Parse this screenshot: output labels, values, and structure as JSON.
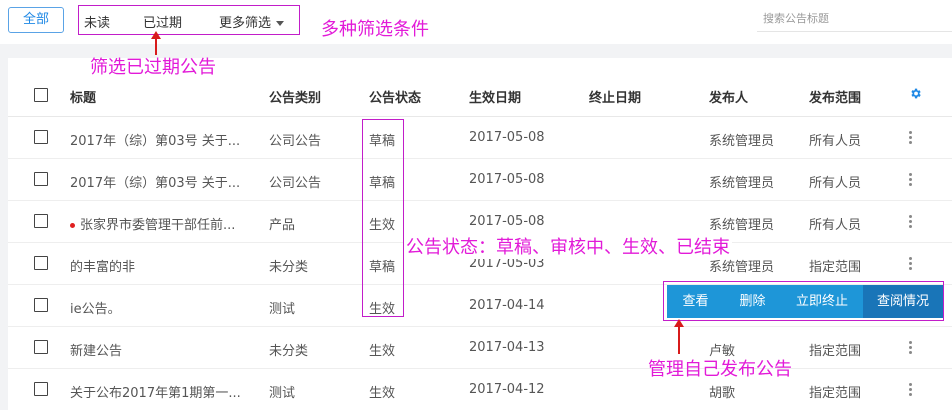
{
  "toolbar": {
    "all_label": "全部",
    "filters": [
      "未读",
      "已过期",
      "更多筛选"
    ],
    "search_placeholder": "搜索公告标题"
  },
  "table": {
    "columns": [
      "标题",
      "公告类别",
      "公告状态",
      "生效日期",
      "终止日期",
      "发布人",
      "发布范围"
    ],
    "rows": [
      {
        "title": "2017年（综）第03号 关于...",
        "category": "公司公告",
        "status": "草稿",
        "effective": "2017-05-08",
        "end": "",
        "publisher": "系统管理员",
        "scope": "所有人员",
        "unread": false
      },
      {
        "title": "2017年（综）第03号 关于...",
        "category": "公司公告",
        "status": "草稿",
        "effective": "2017-05-08",
        "end": "",
        "publisher": "系统管理员",
        "scope": "所有人员",
        "unread": false
      },
      {
        "title": "张家界市委管理干部任前...",
        "category": "产品",
        "status": "生效",
        "effective": "2017-05-08",
        "end": "",
        "publisher": "系统管理员",
        "scope": "所有人员",
        "unread": true
      },
      {
        "title": "的丰富的非",
        "category": "未分类",
        "status": "草稿",
        "effective": "2017-05-03",
        "end": "",
        "publisher": "系统管理员",
        "scope": "指定范围",
        "unread": false
      },
      {
        "title": "ie公告。",
        "category": "测试",
        "status": "生效",
        "effective": "2017-04-14",
        "end": "",
        "publisher": "",
        "scope": "",
        "unread": false
      },
      {
        "title": "新建公告",
        "category": "未分类",
        "status": "生效",
        "effective": "2017-04-13",
        "end": "",
        "publisher": "卢敏",
        "scope": "指定范围",
        "unread": false
      },
      {
        "title": "关于公布2017年第1期第一...",
        "category": "测试",
        "status": "生效",
        "effective": "2017-04-12",
        "end": "",
        "publisher": "胡歌",
        "scope": "指定范围",
        "unread": false
      }
    ]
  },
  "row_actions": [
    "查看",
    "删除",
    "立即终止",
    "查阅情况"
  ],
  "annotations": {
    "filter_conditions": "多种筛选条件",
    "filter_expired": "筛选已过期公告",
    "status_note": "公告状态：草稿、审核中、生效、已结束",
    "manage_note": "管理自己发布公告"
  },
  "colors": {
    "accent": "#1e88e5",
    "annotation": "#e21ad8",
    "action_bg": "#1e96d8",
    "action_dark": "#1975b8"
  }
}
